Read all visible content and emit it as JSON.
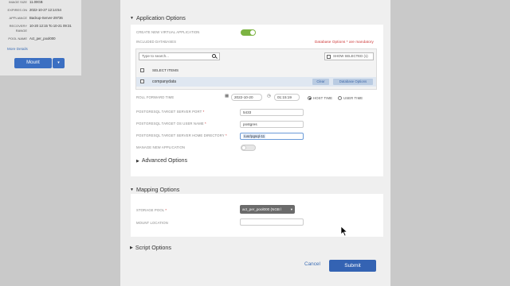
{
  "left_panel": {
    "rows": [
      {
        "key": "IMAGE SIZE",
        "value": "11.00GB"
      },
      {
        "key": "EXPIRES ON",
        "value": "2022-10-27 12:14:54"
      },
      {
        "key": "APPLIANCE",
        "value": "Backup-Server-29736"
      },
      {
        "key": "RECOVERY",
        "value": "10-20 12:15 To 10-21 09:31"
      },
      {
        "key": "RANGE",
        "value": ""
      },
      {
        "key": "POOL NAME",
        "value": "Act_per_pool000"
      }
    ],
    "more_details": "More Details",
    "mount_label": "Mount",
    "mount_caret": "▾"
  },
  "application_options": {
    "header": "Application Options",
    "create_new_label": "CREATE NEW VIRTUAL APPLICATION",
    "create_new_on": true,
    "included_databases_label": "INCLUDED DATABASES",
    "mandatory_note": "Database Options * are mandatory",
    "search_placeholder": "Type to search...",
    "show_selected": "SHOW SELECTED (1)",
    "select_items": "SELECT ITEMS",
    "database": {
      "name": "companydata",
      "clear": "Clear",
      "options": "Database Options"
    },
    "roll_forward_label": "ROLL FORWARD TIME",
    "roll_forward_date": "2022-10-20",
    "roll_forward_time": "01:15:19",
    "host_time": "HOST TIME",
    "user_time": "USER TIME",
    "port_label": "POSTGRESQL TARGET SERVER PORT",
    "port_value": "5433",
    "os_user_label": "POSTGRESQL TARGET OS USER NAME",
    "os_user_value": "postgres",
    "home_dir_label": "POSTGRESQL TARGET SERVER HOME DIRECTORY",
    "home_dir_value": "/usr/pgsql-11",
    "manage_new_label": "MANAGE NEW APPLICATION",
    "manage_new_on": false
  },
  "advanced_options": {
    "header": "Advanced Options"
  },
  "mapping_options": {
    "header": "Mapping Options",
    "storage_pool_label": "STORAGE POOL",
    "storage_pool_value": "act_per_pool000 (NGB l",
    "mount_location_label": "MOUNT LOCATION",
    "mount_location_value": ""
  },
  "script_options": {
    "header": "Script Options"
  },
  "footer": {
    "cancel": "Cancel",
    "submit": "Submit"
  },
  "colors": {
    "accent": "#3463b3",
    "toggle_on": "#7cb342",
    "required": "#cc3333"
  }
}
